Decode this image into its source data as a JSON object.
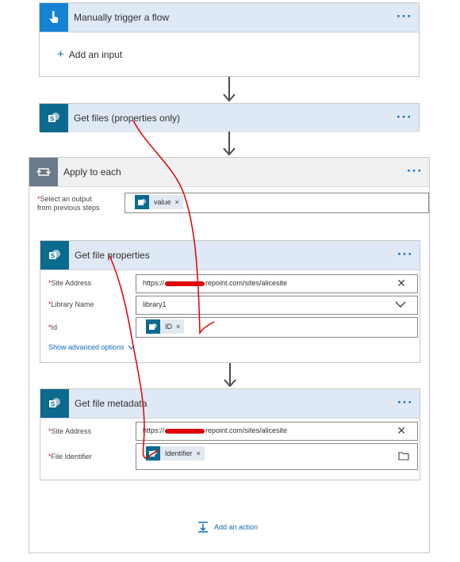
{
  "trigger": {
    "title": "Manually trigger a flow",
    "add_input": "Add an input",
    "more": "···"
  },
  "get_files": {
    "title": "Get files (properties only)",
    "more": "···"
  },
  "apply_each": {
    "title": "Apply to each",
    "more": "···",
    "select_label_line1": "Select an output",
    "select_label_line2": "from previous steps",
    "req_marker": "*",
    "token_value": "value",
    "token_remove": "×"
  },
  "get_file_props": {
    "title": "Get file properties",
    "more": "···",
    "site_label": "Site Address",
    "site_value_prefix": "https://",
    "site_value_suffix": "repoint.com/sites/alicesite",
    "library_label": "Library Name",
    "library_value": "library1",
    "id_label": "Id",
    "id_token": "ID",
    "token_remove": "×",
    "show_advanced": "Show advanced options"
  },
  "get_file_meta": {
    "title": "Get file metadata",
    "more": "···",
    "site_label": "Site Address",
    "site_value_prefix": "https://",
    "site_value_suffix": "repoint.com/sites/alicesite",
    "file_id_label": "File Identifier",
    "file_id_token": "Identifier",
    "token_remove": "×"
  },
  "add_action": "Add an action",
  "colors": {
    "header_bg": "#dfe9f5",
    "sharepoint": "#0b6a8e",
    "accent": "#0f6cbd",
    "required": "#c50f1f",
    "annotation": "#e00000"
  }
}
